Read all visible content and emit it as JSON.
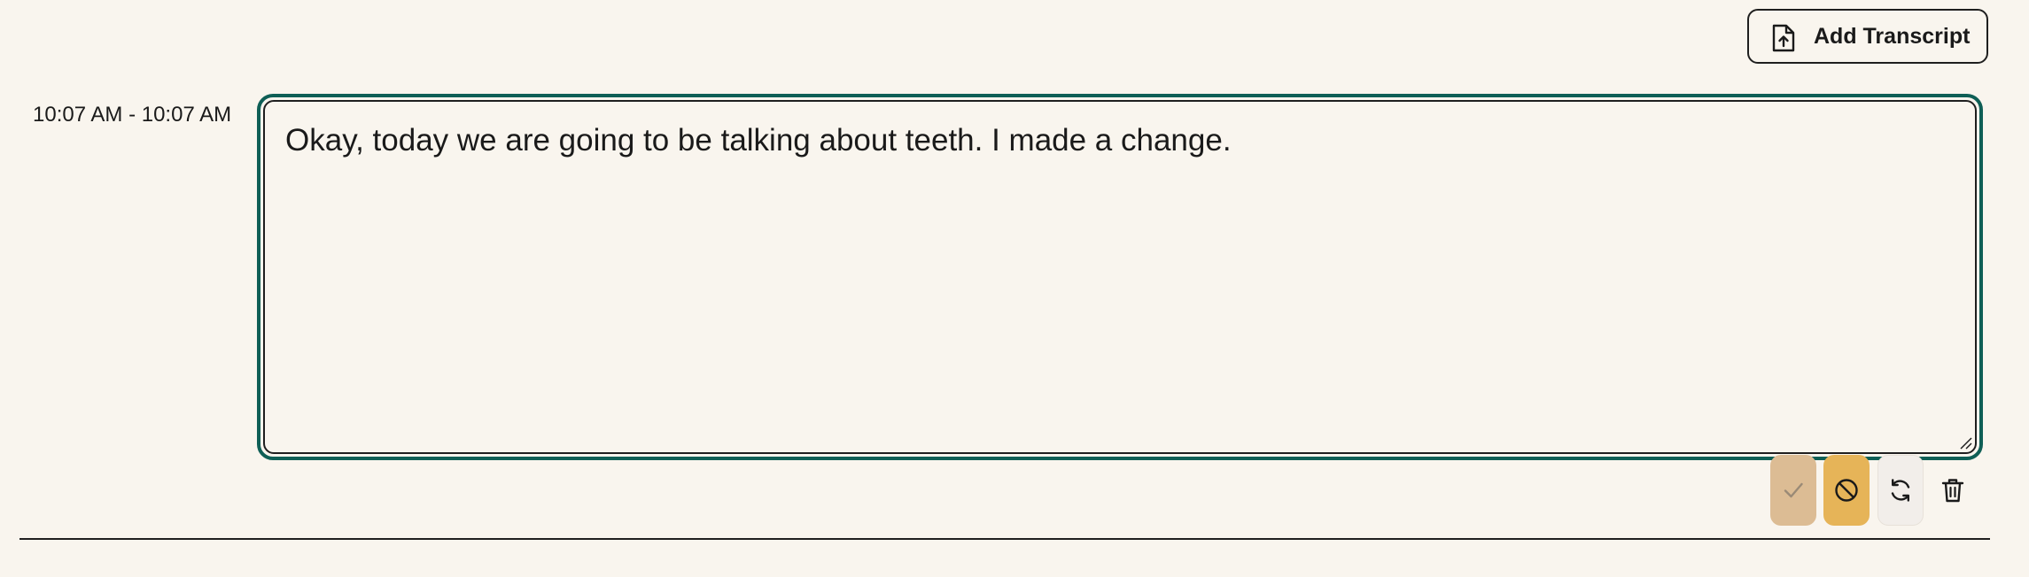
{
  "toolbar": {
    "add_transcript_label": "Add Transcript",
    "add_transcript_icon": "file-upload-icon"
  },
  "segment": {
    "time_range": "10:07 AM - 10:07 AM",
    "text": "Okay, today we are going to be talking about teeth. I made a change.",
    "actions": {
      "approve_icon": "check-icon",
      "reject_icon": "ban-icon",
      "regenerate_icon": "refresh-icon",
      "delete_icon": "trash-icon"
    }
  },
  "colors": {
    "background": "#f9f5ee",
    "editor_focus_border": "#0f5f56",
    "approve_button": "#dcbc94",
    "reject_button": "#e6b458",
    "regenerate_button": "#f2eeea"
  }
}
